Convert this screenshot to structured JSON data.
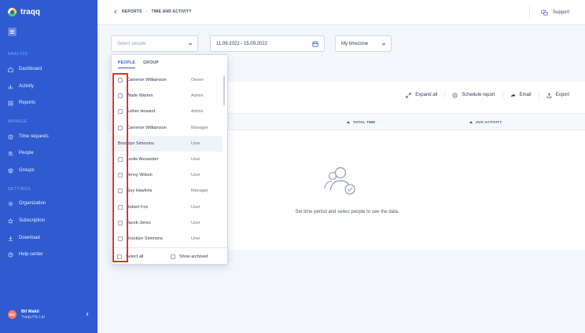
{
  "brand": {
    "name": "traqq"
  },
  "sidebar": {
    "sections": [
      {
        "title": "ANALYZE",
        "items": [
          {
            "label": "Dashboard",
            "icon": "home-icon"
          },
          {
            "label": "Activity",
            "icon": "bar-chart-icon"
          },
          {
            "label": "Reports",
            "icon": "reports-icon"
          }
        ]
      },
      {
        "title": "MANAGE",
        "items": [
          {
            "label": "Time requests",
            "icon": "clock-icon"
          },
          {
            "label": "People",
            "icon": "people-icon"
          },
          {
            "label": "Groups",
            "icon": "groups-icon"
          }
        ]
      },
      {
        "title": "SETTINGS",
        "items": [
          {
            "label": "Organization",
            "icon": "gear-icon"
          },
          {
            "label": "Subscription",
            "icon": "star-icon"
          },
          {
            "label": "Download",
            "icon": "download-icon"
          },
          {
            "label": "Help center",
            "icon": "help-icon"
          }
        ]
      }
    ],
    "user": {
      "initials": "BW",
      "name": "Bil Wakil",
      "company": "Traqq Pty Ltd"
    }
  },
  "topbar": {
    "breadcrumb": [
      "REPORTS",
      "TIME AND ACTIVITY"
    ],
    "support_label": "Support"
  },
  "filters": {
    "people_placeholder": "Select people",
    "date_range": "11.09.2022 - 15.09.2022",
    "timezone": "My timezone"
  },
  "toolbar": {
    "expand_all": "Expand all",
    "schedule_report": "Schedule report",
    "email": "Email",
    "export": "Export"
  },
  "table": {
    "col_total_time": "TOTAL TIME",
    "col_avg_activity": "AVG ACTIVITY"
  },
  "empty_state": {
    "message": "Set time period and select people to see the data."
  },
  "dropdown": {
    "tabs": [
      "PEOPLE",
      "GROUP"
    ],
    "active_tab": "PEOPLE",
    "people": [
      {
        "name": "Cameron Williamson",
        "role": "Owner"
      },
      {
        "name": "Wade Warren",
        "role": "Admin"
      },
      {
        "name": "Esther Howard",
        "role": "Admin"
      },
      {
        "name": "Cameron Williamson",
        "role": "Manager"
      },
      {
        "name": "Brooklyn Simmons",
        "role": "User"
      },
      {
        "name": "Leslie Alexander",
        "role": "User"
      },
      {
        "name": "Jenny Wilson",
        "role": "User"
      },
      {
        "name": "Guy Hawkins",
        "role": "Manager"
      },
      {
        "name": "Robert Fox",
        "role": "User"
      },
      {
        "name": "Jacob Jones",
        "role": "User"
      },
      {
        "name": "Brooklyn Simmons",
        "role": "User"
      }
    ],
    "select_all": "Select all",
    "show_archived": "Show archived"
  }
}
